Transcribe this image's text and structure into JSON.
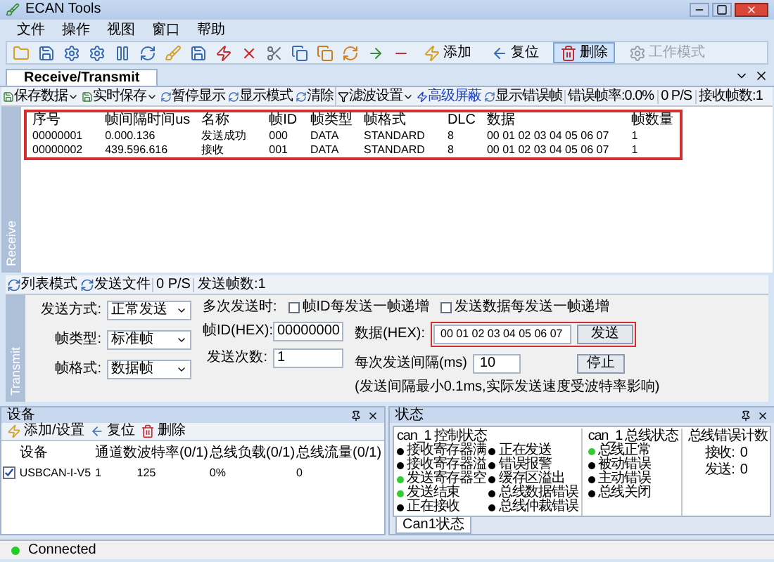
{
  "window": {
    "title": "ECAN Tools"
  },
  "menu": [
    "文件",
    "操作",
    "视图",
    "窗口",
    "帮助"
  ],
  "toolbar": [
    {
      "label": "添加",
      "selected": false,
      "disabled": false
    },
    {
      "label": "复位",
      "selected": false,
      "disabled": false
    },
    {
      "label": "删除",
      "selected": true,
      "disabled": false
    },
    {
      "label": "工作模式",
      "selected": false,
      "disabled": true
    }
  ],
  "tabs": [
    {
      "label": "Receive/Transmit",
      "selected": true
    }
  ],
  "receive": {
    "side_label": "Receive",
    "toolbar": [
      {
        "kind": "menu",
        "label": "保存数据"
      },
      {
        "kind": "menu",
        "label": "实时保存"
      },
      {
        "kind": "button",
        "label": "暂停显示"
      },
      {
        "kind": "button",
        "label": "显示模式"
      },
      {
        "kind": "button",
        "label": "清除"
      },
      {
        "kind": "select",
        "label": "滤波设置"
      },
      {
        "kind": "link",
        "label": "高级屏蔽"
      },
      {
        "kind": "button",
        "label": "显示错误帧"
      },
      {
        "kind": "stat",
        "label": "错误帧率:0.0%"
      },
      {
        "kind": "stat",
        "label": "0 P/S"
      },
      {
        "kind": "stat",
        "label": "接收帧数:1"
      }
    ],
    "columns": [
      "序号",
      "帧间隔时间us",
      "名称",
      "帧ID",
      "帧类型",
      "帧格式",
      "DLC",
      "数据",
      "帧数量"
    ],
    "rows": [
      [
        "00000001",
        "0.000.136",
        "发送成功",
        "000",
        "DATA",
        "STANDARD",
        "8",
        "00 01 02 03 04 05 06 07",
        "1"
      ],
      [
        "00000002",
        "439.596.616",
        "接收",
        "001",
        "DATA",
        "STANDARD",
        "8",
        "00 01 02 03 04 05 06 07",
        "1"
      ]
    ]
  },
  "transmit": {
    "side_label": "Transmit",
    "toolbar": [
      {
        "kind": "button",
        "label": "列表模式"
      },
      {
        "kind": "button",
        "label": "发送文件"
      },
      {
        "kind": "stat",
        "label": "0 P/S"
      },
      {
        "kind": "stat",
        "label": "发送帧数:1"
      }
    ],
    "send_mode": {
      "label": "发送方式:",
      "value": "正常发送"
    },
    "frame_type": {
      "label": "帧类型:",
      "value": "标准帧"
    },
    "frame_format": {
      "label": "帧格式:",
      "value": "数据帧"
    },
    "multi_label": "多次发送时:",
    "checkboxes": [
      {
        "label": "帧ID每发送一帧递增",
        "checked": false
      },
      {
        "label": "发送数据每发送一帧递增",
        "checked": false
      }
    ],
    "frame_id": {
      "label": "帧ID(HEX):",
      "value": "00000000"
    },
    "send_count": {
      "label": "发送次数:",
      "value": "1"
    },
    "data": {
      "label": "数据(HEX):",
      "value": "00 01 02 03 04 05 06 07"
    },
    "send_button": "发送",
    "interval": {
      "label": "每次发送间隔(ms)",
      "value": "10"
    },
    "stop_button": "停止",
    "note": "(发送间隔最小0.1ms,实际发送速度受波特率影响)"
  },
  "devices": {
    "title": "设备",
    "toolbar": [
      "添加/设置",
      "复位",
      "删除"
    ],
    "columns": [
      "设备",
      "通道数",
      "波特率(0/1)",
      "总线负载(0/1)",
      "总线流量(0/1)"
    ],
    "rows": [
      {
        "checked": true,
        "cells": [
          "USBCAN-I-V5",
          "1",
          "125",
          "0%",
          "0"
        ]
      }
    ]
  },
  "status": {
    "title": "状态",
    "control": {
      "title": "can_1 控制状态",
      "columns": [
        [
          {
            "label": "接收寄存器满",
            "color": "#000000"
          },
          {
            "label": "接收寄存器溢",
            "color": "#000000"
          },
          {
            "label": "发送寄存器空",
            "color": "#33cc33"
          },
          {
            "label": "发送结束",
            "color": "#33cc33"
          },
          {
            "label": "正在接收",
            "color": "#000000"
          }
        ],
        [
          {
            "label": "正在发送",
            "color": "#000000"
          },
          {
            "label": "错误报警",
            "color": "#000000"
          },
          {
            "label": "缓存区溢出",
            "color": "#000000"
          },
          {
            "label": "总线数据错误",
            "color": "#000000"
          },
          {
            "label": "总线仲裁错误",
            "color": "#000000"
          }
        ]
      ]
    },
    "bus": {
      "title": "can_1 总线状态",
      "items": [
        {
          "label": "总线正常",
          "color": "#33cc33"
        },
        {
          "label": "被动错误",
          "color": "#000000"
        },
        {
          "label": "主动错误",
          "color": "#000000"
        },
        {
          "label": "总线关闭",
          "color": "#000000"
        }
      ]
    },
    "errors": {
      "title": "总线错误计数",
      "items": [
        {
          "label": "接收:",
          "value": "0"
        },
        {
          "label": "发送:",
          "value": "0"
        }
      ]
    },
    "tabs": [
      {
        "label": "Can1状态",
        "selected": true
      }
    ]
  },
  "status_bar": {
    "text": "Connected",
    "color": "#22cc22"
  }
}
